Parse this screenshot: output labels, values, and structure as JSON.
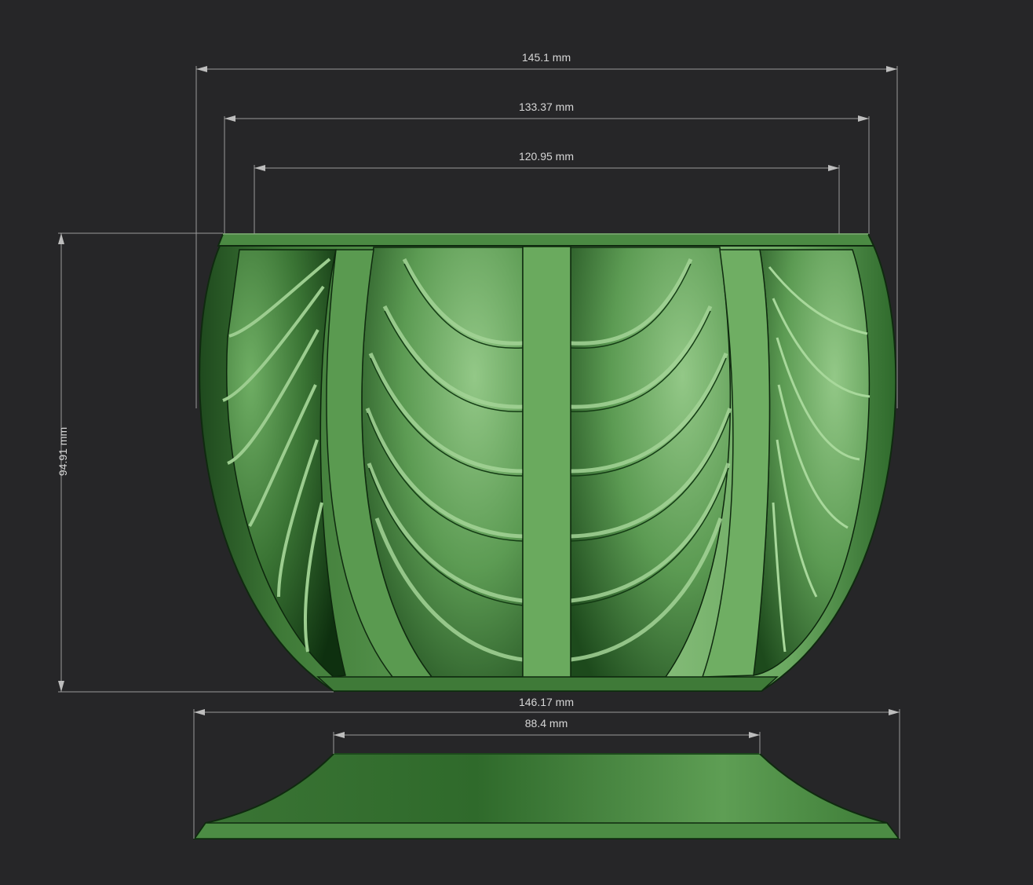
{
  "colors": {
    "background": "#262628",
    "model_light": "#8fc483",
    "model_mid": "#4f8f45",
    "model_dark": "#143c14",
    "dimension_line": "#9a9a9a",
    "dimension_text": "#d6d6d6"
  },
  "dimensions": {
    "top_overall_width": "145.1 mm",
    "rim_outer_width": "133.37 mm",
    "rim_inner_width": "120.95 mm",
    "bowl_height": "94.91 mm",
    "base_overall_width": "146.17 mm",
    "base_top_width": "88.4 mm"
  }
}
